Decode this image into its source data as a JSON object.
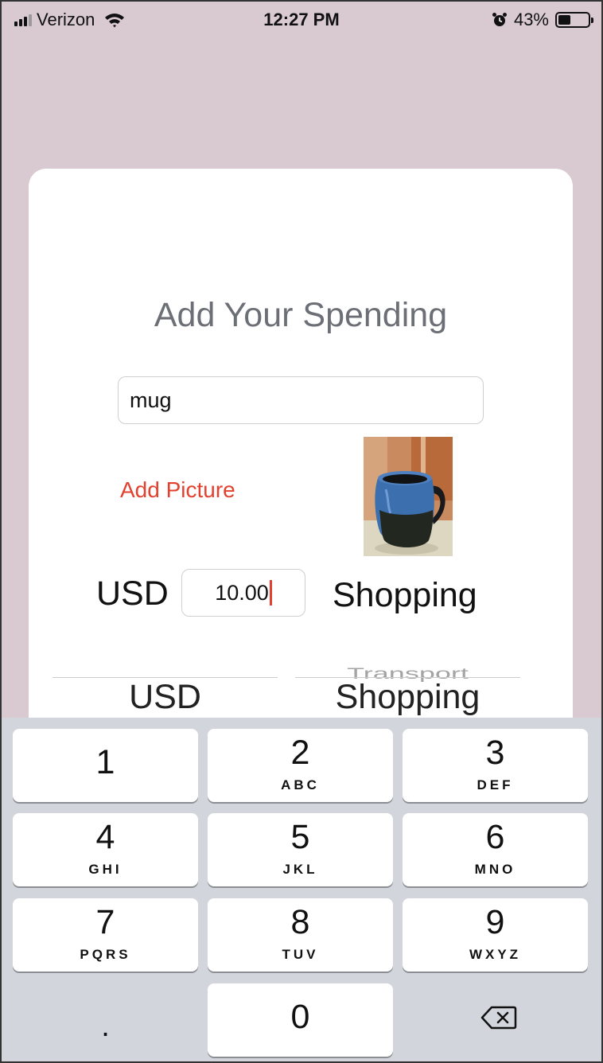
{
  "status_bar": {
    "carrier": "Verizon",
    "time": "12:27 PM",
    "battery_percent": "43%",
    "battery_level": 0.43,
    "icons": [
      "signal-icon",
      "wifi-icon",
      "alarm-icon",
      "battery-icon"
    ]
  },
  "form": {
    "title": "Add Your Spending",
    "name_value": "mug",
    "add_picture_label": "Add Picture",
    "photo_subject": "mug",
    "currency_label": "USD",
    "amount_value": "10.00",
    "category_label": "Shopping",
    "accent_color": "#e3412f"
  },
  "pickers": {
    "currency": {
      "selected": "USD",
      "above": ""
    },
    "category": {
      "selected": "Shopping",
      "above": "Transport"
    }
  },
  "keyboard": {
    "keys": [
      {
        "num": "1",
        "letters": ""
      },
      {
        "num": "2",
        "letters": "ABC"
      },
      {
        "num": "3",
        "letters": "DEF"
      },
      {
        "num": "4",
        "letters": "GHI"
      },
      {
        "num": "5",
        "letters": "JKL"
      },
      {
        "num": "6",
        "letters": "MNO"
      },
      {
        "num": "7",
        "letters": "PQRS"
      },
      {
        "num": "8",
        "letters": "TUV"
      },
      {
        "num": "9",
        "letters": "WXYZ"
      },
      {
        "num": "0",
        "letters": ""
      }
    ],
    "decimal_label": ".",
    "delete_icon": "backspace-icon"
  }
}
